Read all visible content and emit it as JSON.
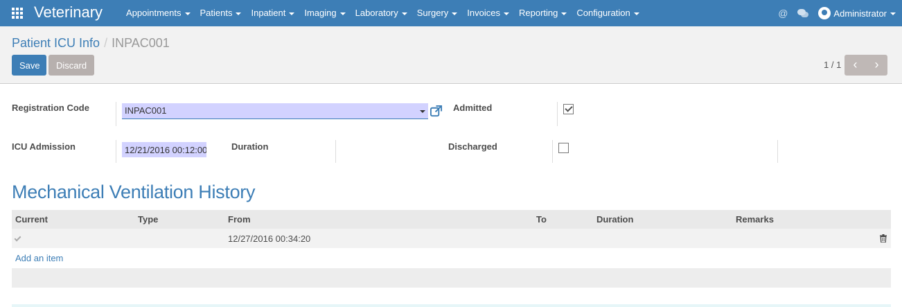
{
  "navbar": {
    "brand": "Veterinary",
    "menu": [
      "Appointments",
      "Patients",
      "Inpatient",
      "Imaging",
      "Laboratory",
      "Surgery",
      "Invoices",
      "Reporting",
      "Configuration"
    ],
    "at_symbol": "@",
    "user": "Administrator"
  },
  "breadcrumb": {
    "parent": "Patient ICU Info",
    "separator": "/",
    "current": "INPAC001"
  },
  "buttons": {
    "save": "Save",
    "discard": "Discard"
  },
  "pager": {
    "value": "1 / 1",
    "prev": "‹",
    "next": "›"
  },
  "form": {
    "registration_code_label": "Registration Code",
    "registration_code_value": "INPAC001",
    "admitted_label": "Admitted",
    "admitted": true,
    "icu_admission_label": "ICU Admission",
    "icu_admission_value": "12/21/2016 00:12:00",
    "duration_label": "Duration",
    "discharged_label": "Discharged",
    "discharged": false
  },
  "section": {
    "title": "Mechanical Ventilation History"
  },
  "table": {
    "columns": [
      "Current",
      "Type",
      "From",
      "To",
      "Duration",
      "Remarks"
    ],
    "rows": [
      {
        "current": true,
        "type": "",
        "from": "12/27/2016 00:34:20",
        "to": "",
        "duration": "",
        "remarks": ""
      }
    ],
    "add_item": "Add an item"
  },
  "colors": {
    "primary": "#3d7eb6",
    "input_bg": "#d2d2ff",
    "discard": "#b7b0ae"
  }
}
